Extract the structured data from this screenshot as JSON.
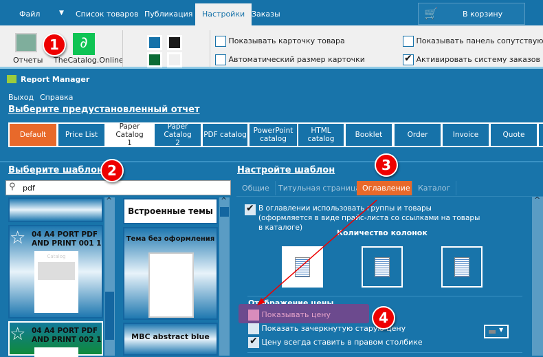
{
  "menu": {
    "tabs": [
      {
        "label": "Файл"
      },
      {
        "label": "Список товаров"
      },
      {
        "label": "Публикация"
      },
      {
        "label": "Настройки"
      },
      {
        "label": "Заказы"
      }
    ],
    "active": "Настройки",
    "cart_button": "В корзину"
  },
  "ribbon": {
    "reports_label": "Отчеты",
    "catalog_online_label": "TheCatalog.Online",
    "colors": [
      "#1672a9",
      "#1a1a1a",
      "#0a6b35",
      "#f0f0f0"
    ],
    "checkboxes": [
      {
        "label": "Показывать карточку товара",
        "checked": false
      },
      {
        "label": "Автоматический размер карточки",
        "checked": false
      },
      {
        "label": "Показывать панель сопутствующих",
        "checked": false
      },
      {
        "label": "Активировать систему заказов",
        "checked": true
      }
    ]
  },
  "report_manager": {
    "title": "Report Manager",
    "menu": [
      "Выход",
      "Справка"
    ],
    "preset_header": "Выберите предустановленный отчет",
    "presets": [
      "Default",
      "Price List",
      "Paper Catalog 1",
      "Paper Catalog 2",
      "PDF catalog",
      "PowerPoint catalog",
      "HTML catalog",
      "Booklet",
      "Order",
      "Invoice",
      "Quote"
    ],
    "active_preset": "Default",
    "selected_preset": "Paper Catalog 1"
  },
  "templates": {
    "header": "Выберите шаблон",
    "search_value": "pdf",
    "items": [
      {
        "name": "04 A4 PORT PDF AND PRINT 001 1"
      },
      {
        "name": "04 A4 PORT PDF AND PRINT 002 1"
      }
    ],
    "thumb_title": "Catalog",
    "themes_header": "Встроенные темы",
    "themes": [
      "Тема без оформления",
      "MBC abstract blue"
    ]
  },
  "settings": {
    "header": "Настройте шаблон",
    "tabs": [
      "Общие",
      "Титульная страница",
      "Оглавление",
      "Каталог"
    ],
    "active_tab": "Оглавление",
    "use_groups_label": "В оглавлении использовать группы и товары (оформляется в виде прайс-листа со ссылками на товары в каталоге)",
    "use_groups_checked": true,
    "columns_header": "Количество колонок",
    "columns_selected": 1,
    "price_header": "Отображение цены",
    "price_options": [
      {
        "label": "Показывать цену",
        "checked": false
      },
      {
        "label": "Показать зачеркнутую старую цену",
        "checked": false
      },
      {
        "label": "Цену всегда ставить в правом столбике",
        "checked": true
      }
    ],
    "old_price_color": "#888888"
  },
  "annotations": [
    "1",
    "2",
    "3",
    "4"
  ],
  "accent": {
    "orange": "#e8692a",
    "blue": "#1672a9",
    "red": "#e00000",
    "highlight": "#6c4a8e"
  }
}
